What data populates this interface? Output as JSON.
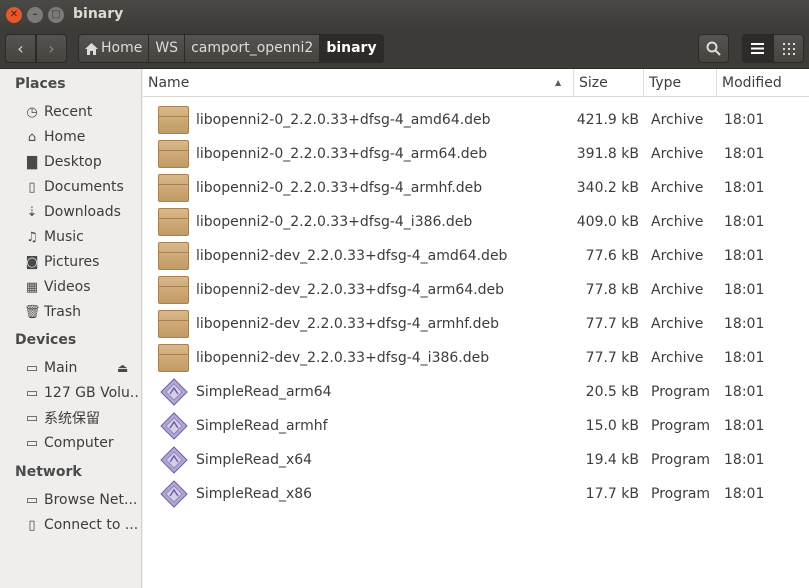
{
  "window": {
    "title": "binary"
  },
  "toolbar": {
    "back_icon": "‹",
    "forward_icon": "›",
    "breadcrumbs": [
      "Home",
      "WS",
      "camport_openni2",
      "binary"
    ],
    "search_icon": "search-icon",
    "list_view_icon": "list-icon",
    "grid_view_icon": "grid-icon"
  },
  "sidebar": {
    "places_title": "Places",
    "places": [
      {
        "label": "Recent",
        "icon": "clock-icon"
      },
      {
        "label": "Home",
        "icon": "home-icon"
      },
      {
        "label": "Desktop",
        "icon": "folder-icon"
      },
      {
        "label": "Documents",
        "icon": "document-icon"
      },
      {
        "label": "Downloads",
        "icon": "download-icon"
      },
      {
        "label": "Music",
        "icon": "music-icon"
      },
      {
        "label": "Pictures",
        "icon": "camera-icon"
      },
      {
        "label": "Videos",
        "icon": "film-icon"
      },
      {
        "label": "Trash",
        "icon": "trash-icon"
      }
    ],
    "devices_title": "Devices",
    "devices": [
      {
        "label": "Main",
        "icon": "drive-icon"
      },
      {
        "label": "127 GB Volu...",
        "icon": "drive-icon"
      },
      {
        "label": "系统保留",
        "icon": "drive-icon"
      },
      {
        "label": "Computer",
        "icon": "drive-icon"
      }
    ],
    "network_title": "Network",
    "network": [
      {
        "label": "Browse Net...",
        "icon": "network-icon"
      },
      {
        "label": "Connect to ...",
        "icon": "network-icon"
      }
    ]
  },
  "columns": {
    "name": "Name",
    "size": "Size",
    "type": "Type",
    "modified": "Modified"
  },
  "files": [
    {
      "name": "libopenni2-0_2.2.0.33+dfsg-4_amd64.deb",
      "size": "421.9 kB",
      "type": "Archive",
      "modified": "18:01",
      "icon": "archive-icon"
    },
    {
      "name": "libopenni2-0_2.2.0.33+dfsg-4_arm64.deb",
      "size": "391.8 kB",
      "type": "Archive",
      "modified": "18:01",
      "icon": "archive-icon"
    },
    {
      "name": "libopenni2-0_2.2.0.33+dfsg-4_armhf.deb",
      "size": "340.2 kB",
      "type": "Archive",
      "modified": "18:01",
      "icon": "archive-icon"
    },
    {
      "name": "libopenni2-0_2.2.0.33+dfsg-4_i386.deb",
      "size": "409.0 kB",
      "type": "Archive",
      "modified": "18:01",
      "icon": "archive-icon"
    },
    {
      "name": "libopenni2-dev_2.2.0.33+dfsg-4_amd64.deb",
      "size": "77.6 kB",
      "type": "Archive",
      "modified": "18:01",
      "icon": "archive-icon"
    },
    {
      "name": "libopenni2-dev_2.2.0.33+dfsg-4_arm64.deb",
      "size": "77.8 kB",
      "type": "Archive",
      "modified": "18:01",
      "icon": "archive-icon"
    },
    {
      "name": "libopenni2-dev_2.2.0.33+dfsg-4_armhf.deb",
      "size": "77.7 kB",
      "type": "Archive",
      "modified": "18:01",
      "icon": "archive-icon"
    },
    {
      "name": "libopenni2-dev_2.2.0.33+dfsg-4_i386.deb",
      "size": "77.7 kB",
      "type": "Archive",
      "modified": "18:01",
      "icon": "archive-icon"
    },
    {
      "name": "SimpleRead_arm64",
      "size": "20.5 kB",
      "type": "Program",
      "modified": "18:01",
      "icon": "program-icon"
    },
    {
      "name": "SimpleRead_armhf",
      "size": "15.0 kB",
      "type": "Program",
      "modified": "18:01",
      "icon": "program-icon"
    },
    {
      "name": "SimpleRead_x64",
      "size": "19.4 kB",
      "type": "Program",
      "modified": "18:01",
      "icon": "program-icon"
    },
    {
      "name": "SimpleRead_x86",
      "size": "17.7 kB",
      "type": "Program",
      "modified": "18:01",
      "icon": "program-icon"
    }
  ]
}
